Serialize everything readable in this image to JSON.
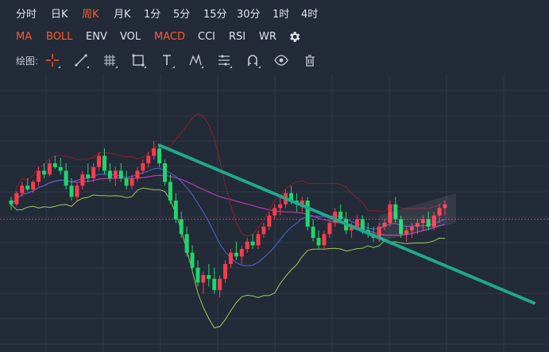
{
  "period_tabs": [
    {
      "label": "分时",
      "active": false
    },
    {
      "label": "日K",
      "active": false
    },
    {
      "label": "周K",
      "active": true
    },
    {
      "label": "月K",
      "active": false
    },
    {
      "label": "1分",
      "active": false
    },
    {
      "label": "5分",
      "active": false
    },
    {
      "label": "15分",
      "active": false
    },
    {
      "label": "30分",
      "active": false
    },
    {
      "label": "1时",
      "active": false
    },
    {
      "label": "4时",
      "active": false
    }
  ],
  "indicator_tabs": [
    {
      "label": "MA",
      "active": true
    },
    {
      "label": "BOLL",
      "active": true
    },
    {
      "label": "ENV",
      "active": false
    },
    {
      "label": "VOL",
      "active": false
    },
    {
      "label": "MACD",
      "active": true
    },
    {
      "label": "CCI",
      "active": false
    },
    {
      "label": "RSI",
      "active": false
    },
    {
      "label": "WR",
      "active": false
    }
  ],
  "settings_icon": "gear-icon",
  "drawing": {
    "label": "绘图:",
    "tools": [
      {
        "name": "crosshair-tool-icon"
      },
      {
        "name": "line-tool-icon"
      },
      {
        "name": "grid-tool-icon"
      },
      {
        "name": "rectangle-tool-icon"
      },
      {
        "name": "text-tool-icon"
      },
      {
        "name": "pattern-tool-icon"
      },
      {
        "name": "fibonacci-tool-icon"
      },
      {
        "name": "magnet-tool-icon"
      },
      {
        "name": "eye-icon"
      },
      {
        "name": "trash-icon"
      }
    ]
  },
  "colors": {
    "background": "#232b38",
    "active": "#ff5b2a",
    "up_candle": "#ff3b4c",
    "down_candle": "#1ed76e",
    "trendline": "#1fa98c",
    "boll_upper": "#8f1f2a",
    "boll_mid": "#4b6ad6",
    "boll_lower": "#9ccc5b",
    "ma_long": "#b43cb0",
    "reference_line": "#d8384a"
  },
  "chart_data": {
    "type": "candlestick",
    "note_units": "relative price index",
    "ylim": [
      0,
      100
    ],
    "candles": [
      [
        60,
        62,
        55,
        58
      ],
      [
        58,
        65,
        57,
        64
      ],
      [
        64,
        70,
        62,
        68
      ],
      [
        68,
        72,
        65,
        66
      ],
      [
        66,
        71,
        64,
        70
      ],
      [
        70,
        78,
        68,
        76
      ],
      [
        76,
        80,
        72,
        74
      ],
      [
        74,
        82,
        73,
        80
      ],
      [
        80,
        84,
        77,
        78
      ],
      [
        78,
        83,
        74,
        76
      ],
      [
        76,
        80,
        66,
        68
      ],
      [
        68,
        72,
        60,
        62
      ],
      [
        62,
        70,
        60,
        68
      ],
      [
        68,
        76,
        66,
        74
      ],
      [
        74,
        80,
        70,
        72
      ],
      [
        72,
        80,
        70,
        78
      ],
      [
        78,
        86,
        76,
        84
      ],
      [
        84,
        88,
        74,
        76
      ],
      [
        76,
        80,
        70,
        72
      ],
      [
        72,
        78,
        68,
        76
      ],
      [
        76,
        80,
        70,
        72
      ],
      [
        72,
        76,
        66,
        68
      ],
      [
        68,
        74,
        66,
        72
      ],
      [
        72,
        78,
        70,
        76
      ],
      [
        76,
        82,
        74,
        80
      ],
      [
        80,
        86,
        78,
        84
      ],
      [
        84,
        92,
        82,
        88
      ],
      [
        88,
        90,
        78,
        80
      ],
      [
        80,
        82,
        68,
        70
      ],
      [
        70,
        74,
        58,
        60
      ],
      [
        60,
        64,
        48,
        50
      ],
      [
        50,
        54,
        40,
        42
      ],
      [
        42,
        46,
        30,
        32
      ],
      [
        32,
        36,
        22,
        24
      ],
      [
        24,
        28,
        14,
        16
      ],
      [
        16,
        22,
        10,
        20
      ],
      [
        20,
        26,
        14,
        18
      ],
      [
        18,
        24,
        10,
        12
      ],
      [
        12,
        20,
        8,
        18
      ],
      [
        18,
        28,
        16,
        26
      ],
      [
        26,
        34,
        24,
        32
      ],
      [
        32,
        38,
        28,
        30
      ],
      [
        30,
        36,
        26,
        34
      ],
      [
        34,
        40,
        32,
        38
      ],
      [
        38,
        42,
        34,
        36
      ],
      [
        36,
        44,
        34,
        42
      ],
      [
        42,
        48,
        40,
        46
      ],
      [
        46,
        54,
        44,
        52
      ],
      [
        52,
        58,
        50,
        56
      ],
      [
        56,
        62,
        52,
        58
      ],
      [
        58,
        66,
        56,
        64
      ],
      [
        64,
        68,
        58,
        60
      ],
      [
        60,
        64,
        54,
        58
      ],
      [
        58,
        62,
        54,
        60
      ],
      [
        60,
        62,
        44,
        46
      ],
      [
        46,
        50,
        38,
        40
      ],
      [
        40,
        44,
        34,
        36
      ],
      [
        36,
        44,
        34,
        42
      ],
      [
        42,
        50,
        40,
        48
      ],
      [
        48,
        56,
        46,
        54
      ],
      [
        54,
        58,
        48,
        50
      ],
      [
        50,
        54,
        42,
        44
      ],
      [
        44,
        48,
        40,
        46
      ],
      [
        46,
        52,
        44,
        50
      ],
      [
        50,
        52,
        42,
        44
      ],
      [
        44,
        48,
        40,
        42
      ],
      [
        42,
        46,
        38,
        40
      ],
      [
        40,
        48,
        38,
        46
      ],
      [
        46,
        50,
        44,
        48
      ],
      [
        48,
        60,
        46,
        58
      ],
      [
        58,
        62,
        48,
        50
      ],
      [
        50,
        52,
        40,
        42
      ],
      [
        42,
        46,
        38,
        44
      ],
      [
        44,
        48,
        40,
        46
      ],
      [
        46,
        50,
        42,
        48
      ],
      [
        48,
        52,
        44,
        50
      ],
      [
        50,
        54,
        44,
        46
      ],
      [
        46,
        54,
        44,
        52
      ],
      [
        52,
        58,
        48,
        56
      ],
      [
        56,
        60,
        52,
        58
      ]
    ]
  }
}
